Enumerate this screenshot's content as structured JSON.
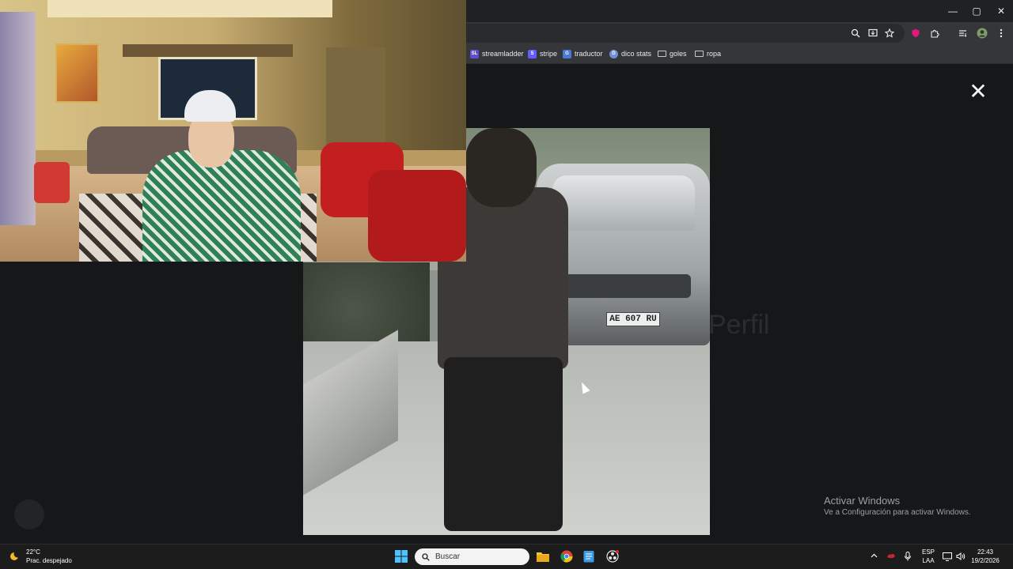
{
  "browser": {
    "window_controls": {
      "minimize": "—",
      "maximize": "▢",
      "close": "✕"
    },
    "toolbar_icons": [
      "zoom-icon",
      "install-icon",
      "star-icon",
      "extension-shield-icon",
      "extensions-icon",
      "tab-search-icon",
      "profile-icon",
      "menu-icon"
    ],
    "bookmarks": [
      {
        "label": "streamladder",
        "icon": "SL",
        "color": "#5b4fcf"
      },
      {
        "label": "stripe",
        "icon": "S",
        "color": "#635bff"
      },
      {
        "label": "traductor",
        "icon": "G",
        "color": "#4a78d6"
      },
      {
        "label": "dico stats",
        "icon": "D",
        "color": "#6f8fd6"
      },
      {
        "label": "goles",
        "icon": "folder"
      },
      {
        "label": "ropa",
        "icon": "folder"
      }
    ]
  },
  "viewer": {
    "close_label": "✕",
    "photo_plate": "AE 607 RU"
  },
  "background_page": {
    "perfil_text": "Perfil"
  },
  "watermark": {
    "title": "Activar Windows",
    "subtitle": "Ve a Configuración para activar Windows."
  },
  "taskbar": {
    "weather_temp": "22°C",
    "weather_desc": "Prac. despejado",
    "search_placeholder": "Buscar",
    "lang_top": "ESP",
    "lang_bottom": "LAA",
    "time": "22:43",
    "date": "19/2/2026"
  }
}
